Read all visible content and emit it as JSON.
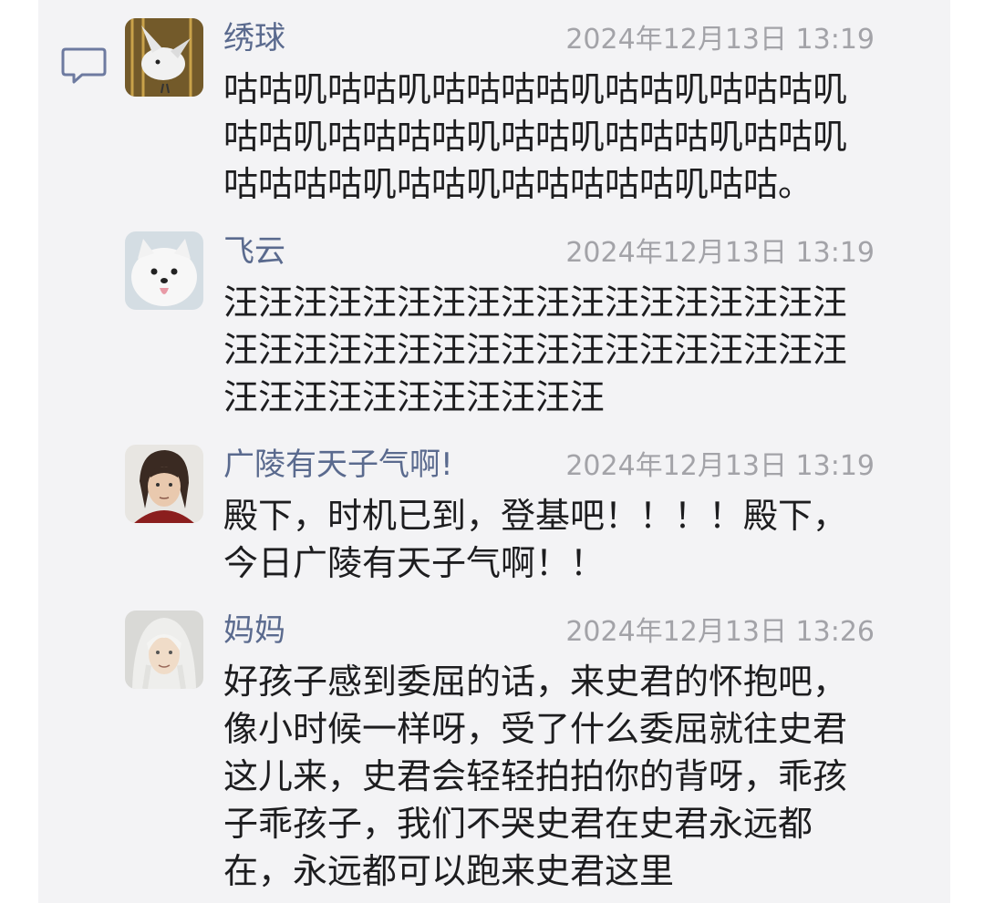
{
  "comments": [
    {
      "avatar_icon": "bird-avatar",
      "name": "绣球",
      "time": "2024年12月13日 13:19",
      "text": "咕咕叽咕咕叽咕咕咕咕叽咕咕叽咕咕咕叽咕咕叽咕咕咕咕叽咕咕叽咕咕咕叽咕咕叽咕咕咕咕叽咕咕叽咕咕咕咕咕叽咕咕。"
    },
    {
      "avatar_icon": "white-dog-avatar",
      "name": "飞云",
      "time": "2024年12月13日 13:19",
      "text": "汪汪汪汪汪汪汪汪汪汪汪汪汪汪汪汪汪汪汪汪汪汪汪汪汪汪汪汪汪汪汪汪汪汪汪汪汪汪汪汪汪汪汪汪汪汪汪"
    },
    {
      "avatar_icon": "dark-haired-man-avatar",
      "name": "广陵有天子气啊!",
      "time": "2024年12月13日 13:19",
      "text": "殿下，时机已到，登基吧！！！！殿下，今日广陵有天子气啊！！"
    },
    {
      "avatar_icon": "white-haired-man-avatar",
      "name": "妈妈",
      "time": "2024年12月13日 13:26",
      "text": "好孩子感到委屈的话，来史君的怀抱吧，像小时候一样呀，受了什么委屈就往史君这儿来，史君会轻轻拍拍你的背呀，乖孩子乖孩子，我们不哭史君在史君永远都在，永远都可以跑来史君这里"
    }
  ],
  "colors": {
    "name": "#5a6a8e",
    "time": "#a3a3a8",
    "text": "#1d1d1f",
    "panel": "#f3f3f5",
    "comment_icon": "#6d7aa0"
  },
  "icons": {
    "comment": "comment-bubble-icon"
  }
}
